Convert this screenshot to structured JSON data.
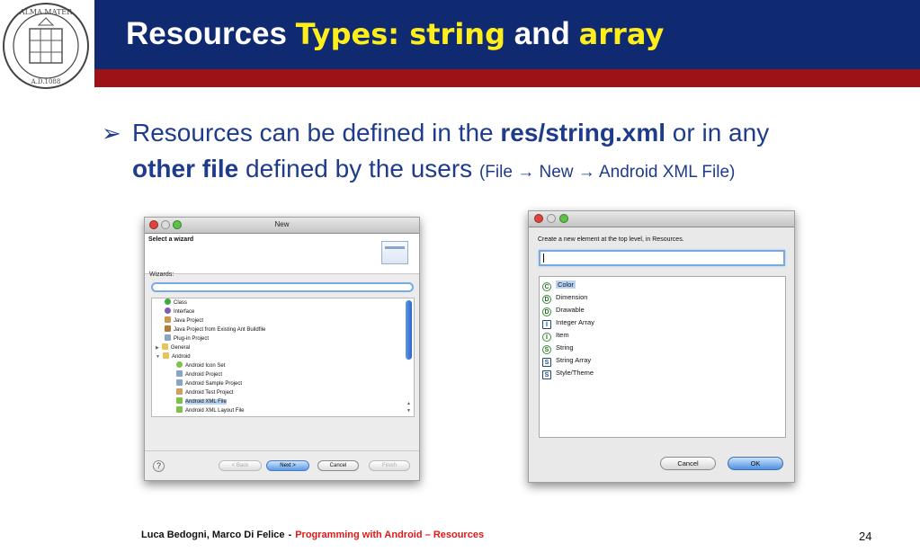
{
  "slide": {
    "title_part1": "Resources ",
    "title_part2": "Types: string",
    "title_part3": " and ",
    "title_part4": "array",
    "bullet_arrow": "➢",
    "bullet_text1": "Resources can be defined in the ",
    "bullet_bold1": "res/string.xml",
    "bullet_text2": " or in any ",
    "bullet_bold2": "other file",
    "bullet_text3": " defined by the users ",
    "bullet_small": "(File → New → Android XML File)",
    "footer_authors": "Luca Bedogni, Marco Di Felice",
    "footer_dash": "-",
    "footer_course": "Programming with Android – Resources",
    "page_number": "24",
    "colors": {
      "header_blue": "#102a72",
      "header_red": "#9c1216",
      "title_yellow": "#ffee1a",
      "body_blue": "#1f3c8c",
      "footer_red": "#e01818"
    }
  },
  "wizard": {
    "window_title": "New",
    "heading": "Select a wizard",
    "wizards_label": "Wizards:",
    "search_value": "",
    "items": [
      {
        "label": "Class",
        "icon": "class-icon"
      },
      {
        "label": "Interface",
        "icon": "interface-icon"
      },
      {
        "label": "Java Project",
        "icon": "project-icon"
      },
      {
        "label": "Java Project from Existing Ant Buildfile",
        "icon": "ant-icon"
      },
      {
        "label": "Plug-in Project",
        "icon": "plugin-icon"
      },
      {
        "label": "General",
        "icon": "folder-icon"
      },
      {
        "label": "Android",
        "icon": "folder-icon"
      },
      {
        "label": "Android Icon Set",
        "icon": "android-icon"
      },
      {
        "label": "Android Project",
        "icon": "android-project-icon"
      },
      {
        "label": "Android Sample Project",
        "icon": "android-sample-icon"
      },
      {
        "label": "Android Test Project",
        "icon": "android-test-icon"
      },
      {
        "label": "Android XML File",
        "icon": "xml-file-icon"
      },
      {
        "label": "Android XML Layout File",
        "icon": "xml-layout-icon"
      }
    ],
    "buttons": {
      "back": "< Back",
      "next": "Next >",
      "cancel": "Cancel",
      "finish": "Finish"
    },
    "help_label": "?"
  },
  "new_element": {
    "prompt": "Create a new element at the top level, in Resources.",
    "filter_value": "",
    "items": [
      {
        "label": "Color",
        "letter": "C"
      },
      {
        "label": "Dimension",
        "letter": "D"
      },
      {
        "label": "Drawable",
        "letter": "D"
      },
      {
        "label": "Integer Array",
        "letter": "I"
      },
      {
        "label": "Item",
        "letter": "I"
      },
      {
        "label": "String",
        "letter": "S"
      },
      {
        "label": "String Array",
        "letter": "S"
      },
      {
        "label": "Style/Theme",
        "letter": "S"
      }
    ],
    "buttons": {
      "cancel": "Cancel",
      "ok": "OK"
    }
  }
}
